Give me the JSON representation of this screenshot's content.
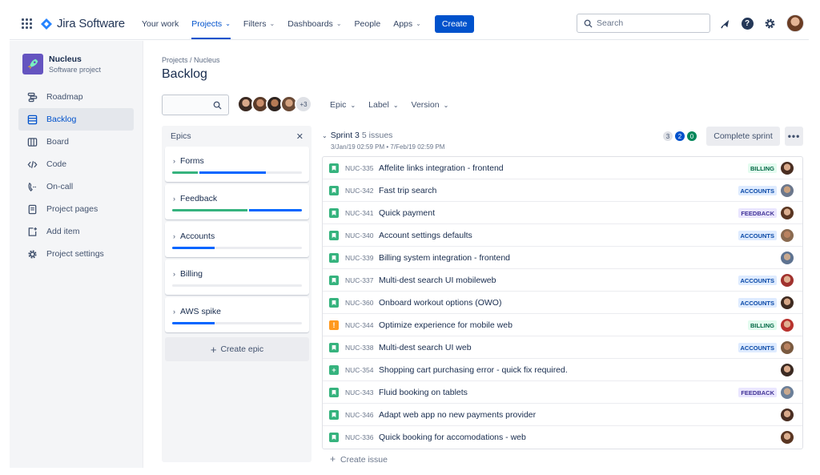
{
  "nav": {
    "brand": "Jira Software",
    "links": [
      {
        "label": "Your work",
        "has_chevron": false,
        "active": false
      },
      {
        "label": "Projects",
        "has_chevron": true,
        "active": true
      },
      {
        "label": "Filters",
        "has_chevron": true,
        "active": false
      },
      {
        "label": "Dashboards",
        "has_chevron": true,
        "active": false
      },
      {
        "label": "People",
        "has_chevron": false,
        "active": false
      },
      {
        "label": "Apps",
        "has_chevron": true,
        "active": false
      }
    ],
    "create_label": "Create",
    "search_placeholder": "Search",
    "icons": [
      "notifications-icon",
      "help-icon",
      "settings-icon"
    ]
  },
  "sidebar": {
    "project_name": "Nucleus",
    "project_type": "Software project",
    "items": [
      {
        "label": "Roadmap",
        "icon": "roadmap-icon",
        "active": false
      },
      {
        "label": "Backlog",
        "icon": "backlog-icon",
        "active": true
      },
      {
        "label": "Board",
        "icon": "board-icon",
        "active": false
      },
      {
        "label": "Code",
        "icon": "code-icon",
        "active": false
      },
      {
        "label": "On-call",
        "icon": "on-call-icon",
        "active": false
      },
      {
        "label": "Project pages",
        "icon": "page-icon",
        "active": false
      },
      {
        "label": "Add item",
        "icon": "add-item-icon",
        "active": false
      },
      {
        "label": "Project settings",
        "icon": "settings-icon",
        "active": false
      }
    ]
  },
  "main": {
    "breadcrumb": "Projects / Nucleus",
    "title": "Backlog",
    "more_avatars": "+3",
    "filters": [
      {
        "label": "Epic"
      },
      {
        "label": "Label"
      },
      {
        "label": "Version"
      }
    ]
  },
  "epics": {
    "header": "Epics",
    "items": [
      {
        "name": "Forms",
        "done": 0.2,
        "in_progress": 0.51
      },
      {
        "name": "Feedback",
        "done": 0.59,
        "in_progress": 0.41
      },
      {
        "name": "Accounts",
        "done": 0.0,
        "in_progress": 0.33
      },
      {
        "name": "Billing",
        "done": 0.0,
        "in_progress": 0.0
      },
      {
        "name": "AWS spike",
        "done": 0.0,
        "in_progress": 0.33
      }
    ],
    "create_label": "Create epic"
  },
  "sprint": {
    "name": "Sprint 3",
    "count": "5 issues",
    "dates": "3/Jan/19 02:59 PM • 7/Feb/19 02:59 PM",
    "badges": {
      "todo": "3",
      "in_progress": "2",
      "done": "0"
    },
    "complete_label": "Complete sprint",
    "issues": [
      {
        "type": "story",
        "key": "NUC-335",
        "summary": "Affelite links integration - frontend",
        "label": "BILLING",
        "label_kind": "billing"
      },
      {
        "type": "story",
        "key": "NUC-342",
        "summary": "Fast trip search",
        "label": "ACCOUNTS",
        "label_kind": "accounts"
      },
      {
        "type": "story",
        "key": "NUC-341",
        "summary": "Quick payment",
        "label": "FEEDBACK",
        "label_kind": "feedback"
      },
      {
        "type": "story",
        "key": "NUC-340",
        "summary": "Account settings defaults",
        "label": "ACCOUNTS",
        "label_kind": "accounts"
      },
      {
        "type": "story",
        "key": "NUC-339",
        "summary": "Billing system integration - frontend",
        "label": "",
        "label_kind": ""
      },
      {
        "type": "story",
        "key": "NUC-337",
        "summary": "Multi-dest search UI mobileweb",
        "label": "ACCOUNTS",
        "label_kind": "accounts"
      },
      {
        "type": "story",
        "key": "NUC-360",
        "summary": "Onboard workout options (OWO)",
        "label": "ACCOUNTS",
        "label_kind": "accounts"
      },
      {
        "type": "bug",
        "key": "NUC-344",
        "summary": "Optimize experience for mobile web",
        "label": "BILLING",
        "label_kind": "billing"
      },
      {
        "type": "story",
        "key": "NUC-338",
        "summary": "Multi-dest search UI web",
        "label": "ACCOUNTS",
        "label_kind": "accounts"
      },
      {
        "type": "task",
        "key": "NUC-354",
        "summary": "Shopping cart purchasing error - quick fix required.",
        "label": "",
        "label_kind": ""
      },
      {
        "type": "story",
        "key": "NUC-343",
        "summary": "Fluid booking on tablets",
        "label": "FEEDBACK",
        "label_kind": "feedback"
      },
      {
        "type": "story",
        "key": "NUC-346",
        "summary": "Adapt web app no new payments provider",
        "label": "",
        "label_kind": ""
      },
      {
        "type": "story",
        "key": "NUC-336",
        "summary": "Quick booking for accomodations - web",
        "label": "",
        "label_kind": ""
      }
    ],
    "create_issue_label": "Create issue"
  }
}
